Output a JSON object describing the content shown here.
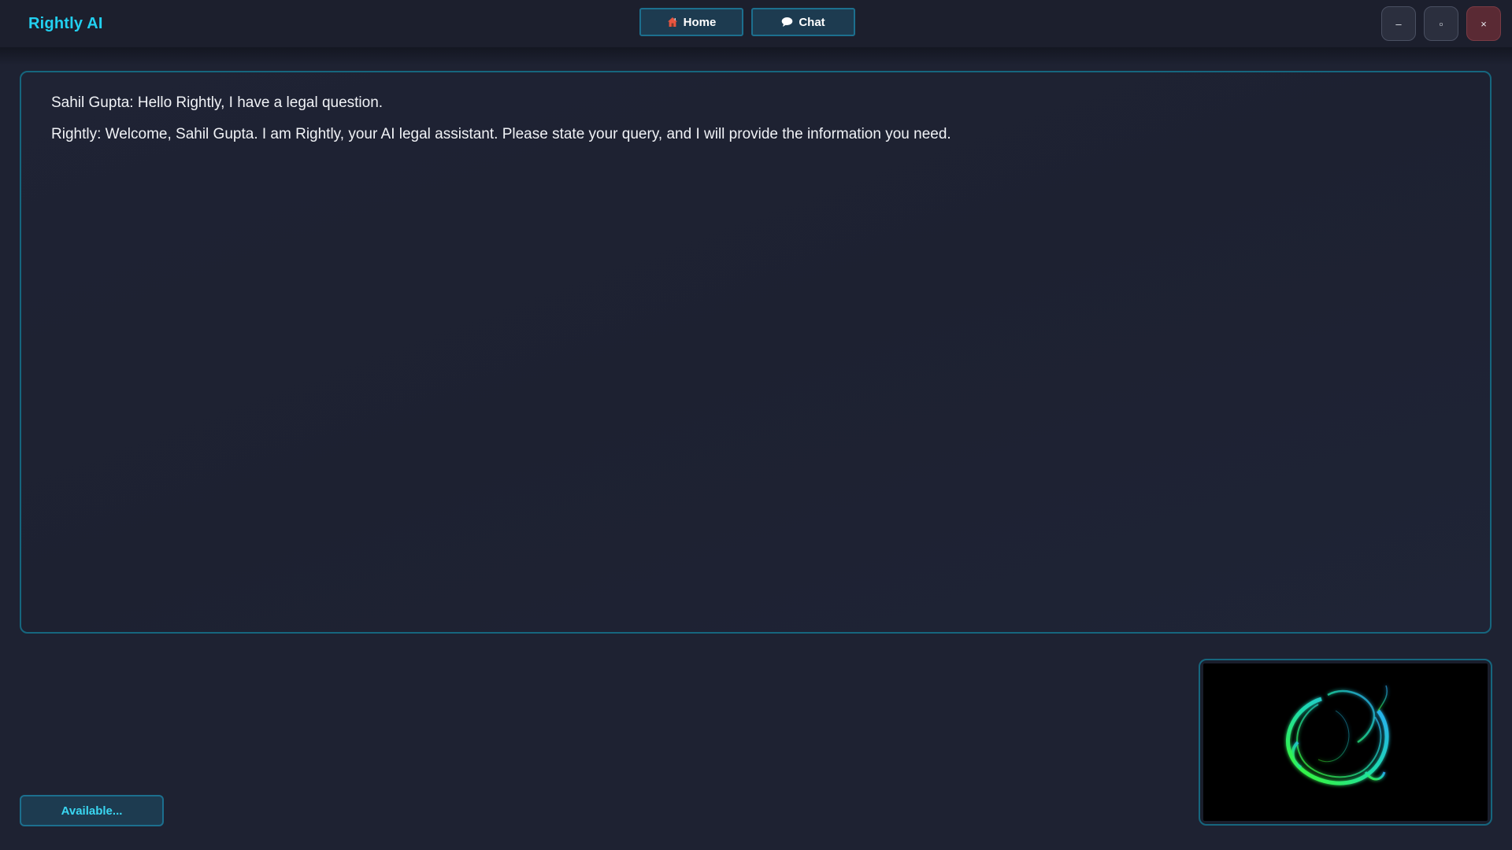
{
  "app": {
    "title": "Rightly AI"
  },
  "nav": {
    "home_label": "Home",
    "chat_label": "Chat",
    "home_icon": "house-icon",
    "chat_icon": "speech-bubble-icon"
  },
  "window_controls": {
    "minimize_glyph": "–",
    "maximize_glyph": "▫",
    "close_glyph": "×"
  },
  "chat": {
    "messages": [
      "Sahil Gupta: Hello Rightly, I have a legal question.",
      "Rightly: Welcome, Sahil Gupta. I am Rightly, your AI legal assistant. Please state your query, and I will provide the information you need."
    ]
  },
  "status": {
    "label": "Available..."
  },
  "colors": {
    "accent": "#22d0f0",
    "panel_border": "#16667e",
    "background": "#1e2232"
  }
}
